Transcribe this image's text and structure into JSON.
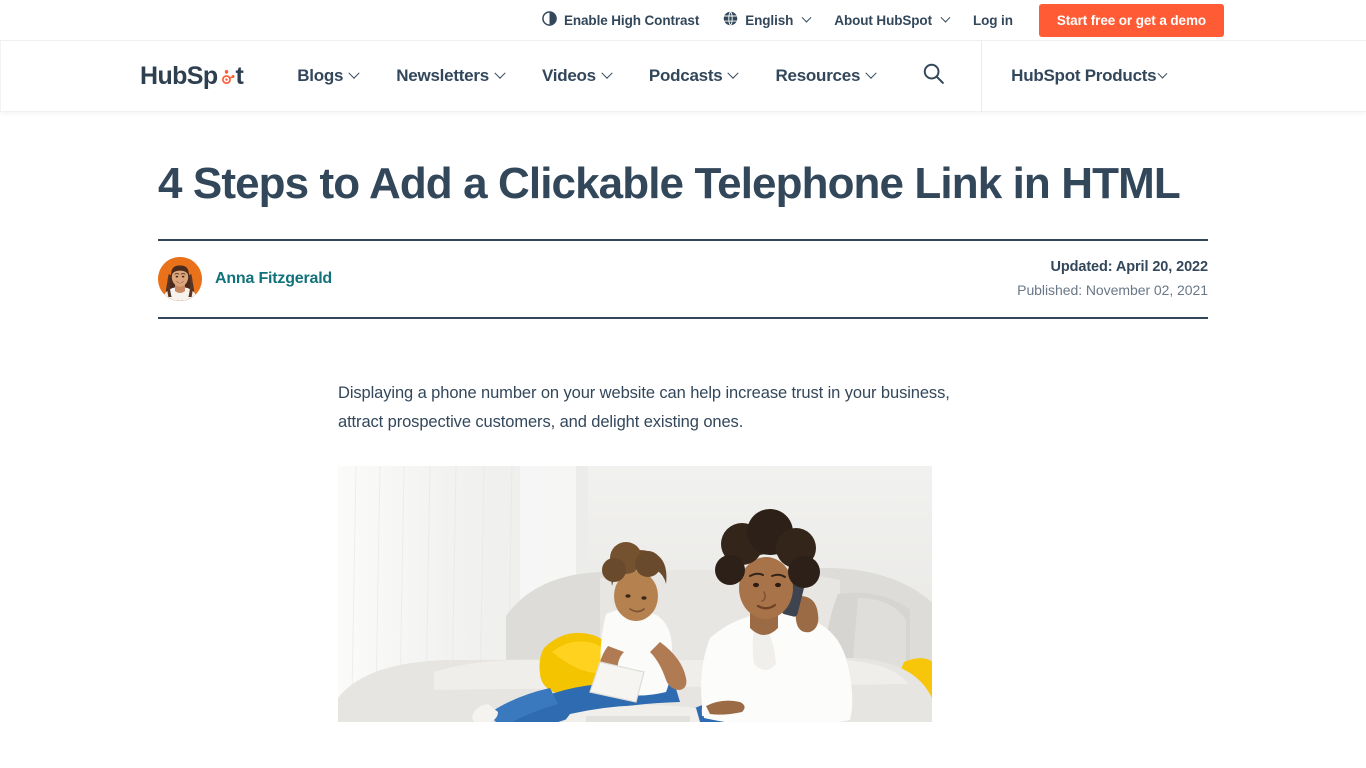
{
  "colors": {
    "brand_orange": "#ff5c35",
    "slate": "#33475b",
    "teal": "#12727b",
    "muted": "#6a7786",
    "avatar_bg": "#e8711a"
  },
  "utility_bar": {
    "high_contrast": {
      "label": "Enable High Contrast",
      "icon": "contrast-icon"
    },
    "language": {
      "label": "English",
      "icon": "globe-icon",
      "caret": "chevron-down-icon"
    },
    "about": {
      "label": "About HubSpot",
      "caret": "chevron-down-icon"
    },
    "login": {
      "label": "Log in"
    },
    "cta": {
      "label": "Start free or get a demo"
    }
  },
  "nav": {
    "logo": {
      "text_before": "HubSp",
      "text_after": "t",
      "icon": "hubspot-sprocket-icon",
      "alt": "HubSpot"
    },
    "items": [
      {
        "label": "Blogs",
        "caret": "chevron-down-icon"
      },
      {
        "label": "Newsletters",
        "caret": "chevron-down-icon"
      },
      {
        "label": "Videos",
        "caret": "chevron-down-icon"
      },
      {
        "label": "Podcasts",
        "caret": "chevron-down-icon"
      },
      {
        "label": "Resources",
        "caret": "chevron-down-icon"
      }
    ],
    "search": {
      "icon": "search-icon",
      "label": "Search"
    },
    "products": {
      "label": "HubSpot Products",
      "caret": "chevron-down-icon"
    }
  },
  "article": {
    "title": "4 Steps to Add a Clickable Telephone Link in HTML",
    "author": {
      "name": "Anna Fitzgerald",
      "avatar_alt": "Anna Fitzgerald"
    },
    "updated": "Updated: April 20, 2022",
    "published": "Published: November 02, 2021",
    "lede": "Displaying a phone number on your website can help increase trust in your business, attract prospective customers, and delight existing ones.",
    "hero_image": {
      "alt": "Woman talking on a mobile phone while sitting on a couch next to a young girl writing in a notebook",
      "caption": ""
    }
  }
}
